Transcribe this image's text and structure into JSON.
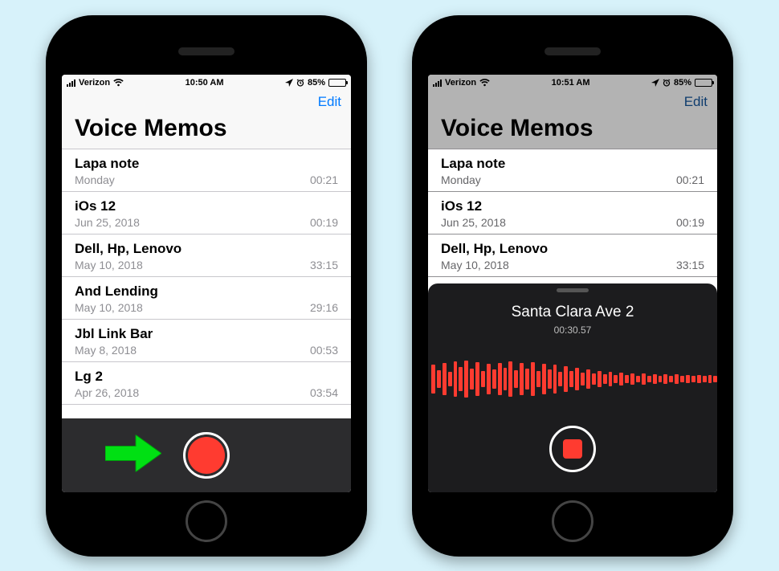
{
  "status_left": {
    "carrier": "Verizon",
    "time": "10:50 AM",
    "loc_icon": "location-icon",
    "alarm_icon": "alarm-icon",
    "battery_pct": "85%"
  },
  "status_right": {
    "carrier": "Verizon",
    "time": "10:51 AM",
    "loc_icon": "location-icon",
    "alarm_icon": "alarm-icon",
    "battery_pct": "85%"
  },
  "nav": {
    "edit": "Edit"
  },
  "title": "Voice Memos",
  "memos": [
    {
      "name": "Lapa note",
      "date": "Monday",
      "dur": "00:21"
    },
    {
      "name": "iOs 12",
      "date": "Jun 25, 2018",
      "dur": "00:19"
    },
    {
      "name": "Dell, Hp, Lenovo",
      "date": "May 10, 2018",
      "dur": "33:15"
    },
    {
      "name": "And Lending",
      "date": "May 10, 2018",
      "dur": "29:16"
    },
    {
      "name": "Jbl Link Bar",
      "date": "May 8, 2018",
      "dur": "00:53"
    },
    {
      "name": "Lg 2",
      "date": "Apr 26, 2018",
      "dur": "03:54"
    }
  ],
  "recording": {
    "name": "Santa Clara Ave 2",
    "elapsed": "00:30.57"
  },
  "colors": {
    "ios_blue": "#007aff",
    "ios_red": "#ff3b30",
    "accent_arrow": "#00e013"
  }
}
